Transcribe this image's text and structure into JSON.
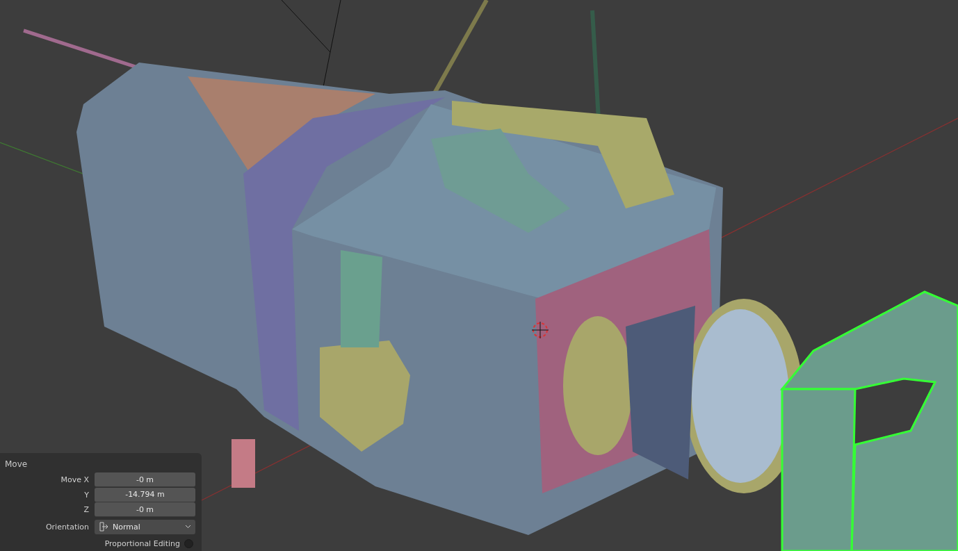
{
  "panel": {
    "title": "Move",
    "fields": [
      {
        "label": "Move X",
        "value": "-0 m"
      },
      {
        "label": "Y",
        "value": "-14.794 m"
      },
      {
        "label": "Z",
        "value": "-0 m"
      }
    ],
    "orientation": {
      "label": "Orientation",
      "value": "Normal"
    },
    "proportional_editing": {
      "label": "Proportional Editing",
      "checked": false
    }
  }
}
